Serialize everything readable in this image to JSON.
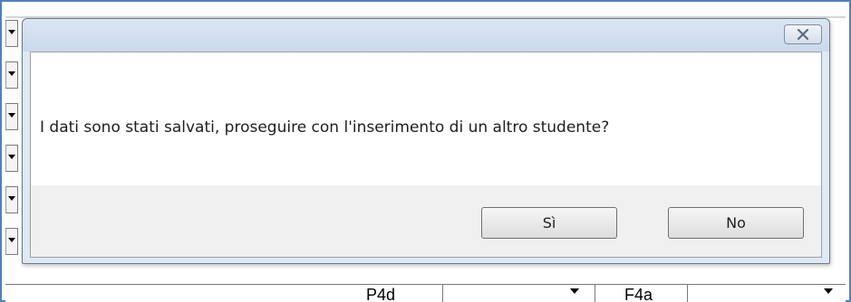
{
  "dialog": {
    "message": "I dati sono stati salvati, proseguire con l'inserimento di un altro studente?",
    "buttons": {
      "yes_label": "Sì",
      "no_label": "No"
    },
    "close_icon": "close-x-icon"
  },
  "background_form": {
    "bottom_row": {
      "label_left": "P4d",
      "label_right": "F4a"
    }
  },
  "colors": {
    "frame_border": "#4f81bd",
    "titlebar": "#c9d9ec",
    "close_x": "#5a6a7e"
  }
}
